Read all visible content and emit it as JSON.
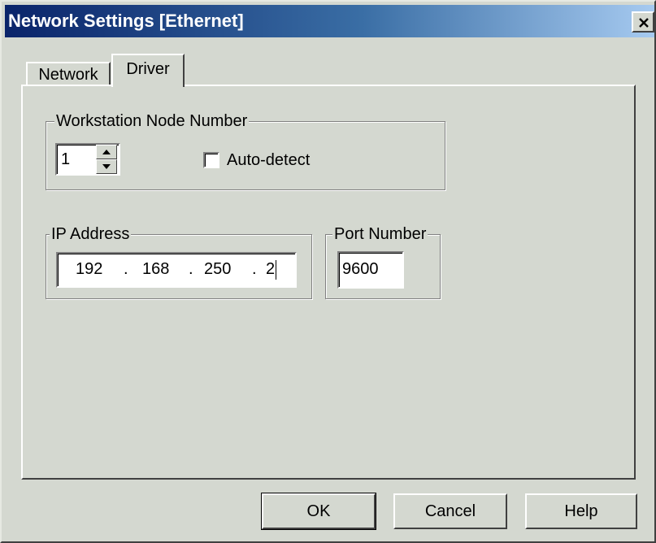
{
  "window": {
    "title": "Network Settings [Ethernet]"
  },
  "tabs": [
    {
      "label": "Network",
      "active": false
    },
    {
      "label": "Driver",
      "active": true
    }
  ],
  "node_group": {
    "legend": "Workstation Node Number",
    "node_value": "1",
    "autodetect_label": "Auto-detect",
    "autodetect_checked": false
  },
  "ip_group": {
    "legend": "IP Address",
    "octets": [
      "192",
      "168",
      "250",
      "2"
    ]
  },
  "port_group": {
    "legend": "Port Number",
    "value": "9600"
  },
  "buttons": {
    "ok": "OK",
    "cancel": "Cancel",
    "help": "Help"
  },
  "icons": [
    "close-icon",
    "spin-up-icon",
    "spin-down-icon"
  ],
  "colors": {
    "title_start": "#0a246a",
    "title_end": "#a6caf0",
    "face": "#d4d8d0"
  }
}
